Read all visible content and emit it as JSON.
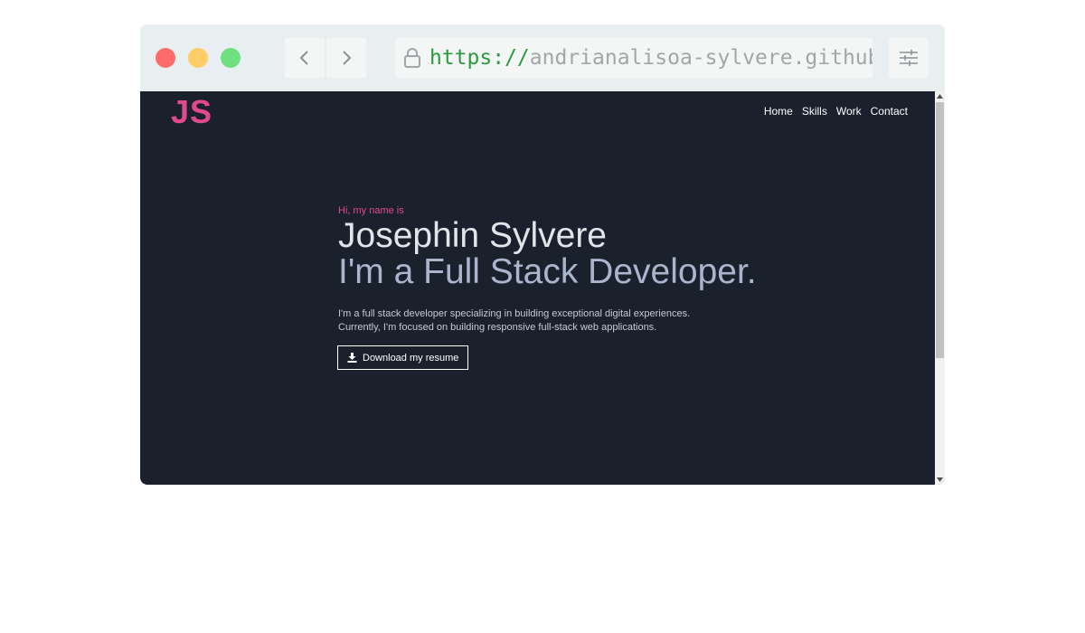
{
  "browser": {
    "url_scheme": "https://",
    "url_rest": "andrianalisoa-sylvere.github",
    "icons": {
      "back": "chevron-left-icon",
      "forward": "chevron-right-icon",
      "lock": "lock-icon",
      "settings": "sliders-icon"
    },
    "colors": {
      "close": "#ff6b6b",
      "minimize": "#ffcc66",
      "maximize": "#6ee080",
      "url_scheme": "#2b9a3e",
      "url_rest": "#a3a6a8"
    }
  },
  "site": {
    "logo": "JS",
    "nav": [
      "Home",
      "Skills",
      "Work",
      "Contact"
    ],
    "hero": {
      "greeting": "Hi, my name is",
      "name": "Josephin Sylvere",
      "role": "I'm a Full Stack Developer.",
      "description_line1": "I'm a full stack developer specializing in building exceptional digital experiences.",
      "description_line2": "Currently, I'm focused on building responsive full-stack web applications.",
      "resume_button": "Download my resume"
    },
    "colors": {
      "background": "#1b202d",
      "accent": "#e0498f",
      "name": "#e1e4e8",
      "role": "#aab4cc",
      "text": "#c5cad3"
    }
  }
}
